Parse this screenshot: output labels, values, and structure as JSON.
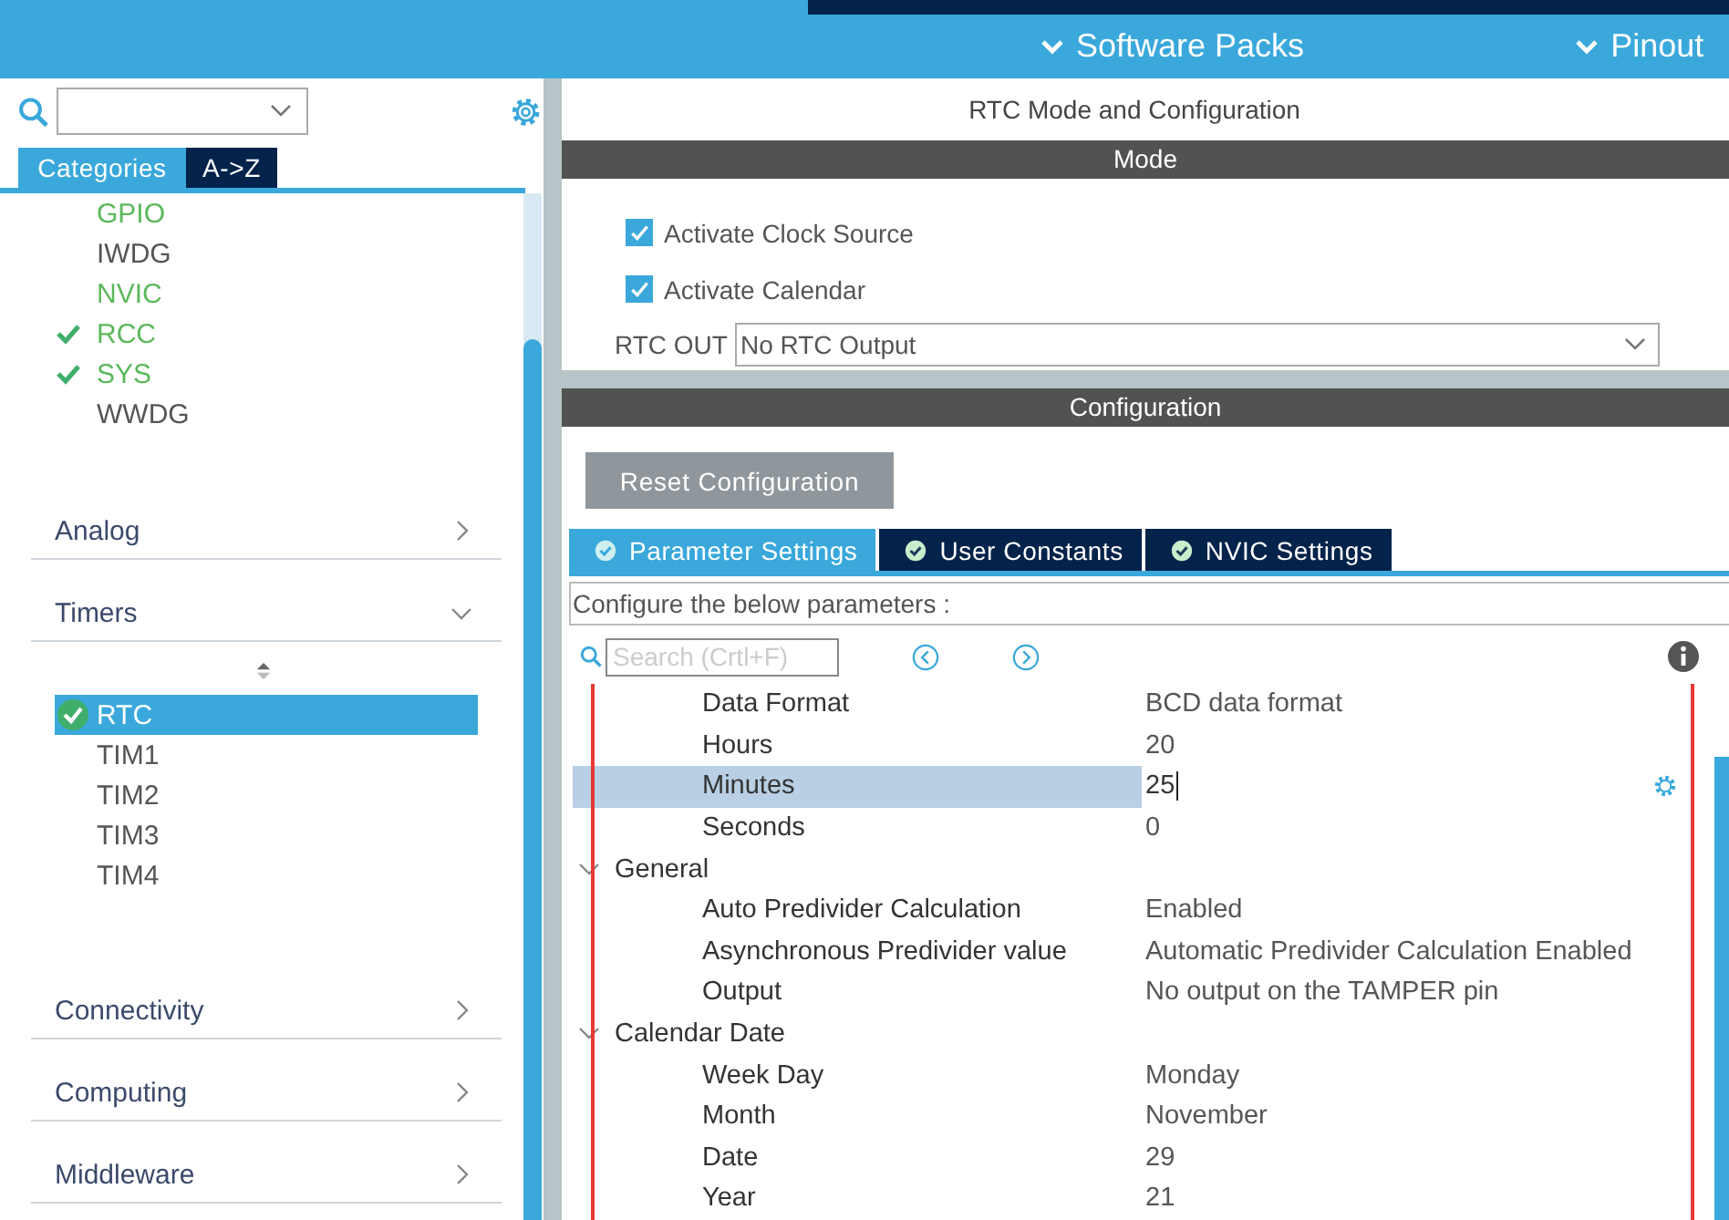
{
  "header": {
    "menus": [
      {
        "label": "Software Packs"
      },
      {
        "label": "Pinout"
      }
    ]
  },
  "sidebar": {
    "tabs": [
      {
        "label": "Categories",
        "selected": true
      },
      {
        "label": "A->Z",
        "selected": false
      }
    ],
    "peripherals": [
      {
        "label": "GPIO",
        "enabled": true,
        "checked": false
      },
      {
        "label": "IWDG",
        "enabled": false,
        "checked": false
      },
      {
        "label": "NVIC",
        "enabled": true,
        "checked": false
      },
      {
        "label": "RCC",
        "enabled": true,
        "checked": true
      },
      {
        "label": "SYS",
        "enabled": true,
        "checked": true
      },
      {
        "label": "WWDG",
        "enabled": false,
        "checked": false
      }
    ],
    "categories": [
      {
        "label": "Analog",
        "expanded": false
      },
      {
        "label": "Timers",
        "expanded": true,
        "children": [
          {
            "label": "RTC",
            "selected": true,
            "checked": true
          },
          {
            "label": "TIM1",
            "selected": false,
            "checked": false
          },
          {
            "label": "TIM2",
            "selected": false,
            "checked": false
          },
          {
            "label": "TIM3",
            "selected": false,
            "checked": false
          },
          {
            "label": "TIM4",
            "selected": false,
            "checked": false
          }
        ]
      },
      {
        "label": "Connectivity",
        "expanded": false
      },
      {
        "label": "Computing",
        "expanded": false
      },
      {
        "label": "Middleware",
        "expanded": false
      }
    ]
  },
  "main": {
    "title": "RTC Mode and Configuration",
    "mode": {
      "heading": "Mode",
      "checkboxes": [
        {
          "label": "Activate Clock Source",
          "checked": true
        },
        {
          "label": "Activate Calendar",
          "checked": true
        }
      ],
      "rtc_out": {
        "label": "RTC OUT",
        "value": "No RTC Output"
      }
    },
    "configuration": {
      "heading": "Configuration",
      "reset_button": "Reset Configuration",
      "tabs": [
        {
          "label": "Parameter Settings",
          "selected": true
        },
        {
          "label": "User Constants",
          "selected": false
        },
        {
          "label": "NVIC Settings",
          "selected": false
        }
      ],
      "description": "Configure the below parameters :",
      "search": {
        "placeholder": "Search (Crtl+F)"
      },
      "parameters": [
        {
          "label": "Data Format",
          "value": "BCD data format",
          "selected": false
        },
        {
          "label": "Hours",
          "value": "20",
          "selected": false
        },
        {
          "label": "Minutes",
          "value": "25",
          "selected": true
        },
        {
          "label": "Seconds",
          "value": "0",
          "selected": false
        },
        {
          "label": "General",
          "expanded": true,
          "children": [
            {
              "label": "Auto Predivider Calculation",
              "value": "Enabled",
              "selected": false
            },
            {
              "label": "Asynchronous Predivider value",
              "value": "Automatic Predivider Calculation Enabled",
              "selected": false
            },
            {
              "label": "Output",
              "value": "No output on the TAMPER pin",
              "selected": false
            }
          ]
        },
        {
          "label": "Calendar Date",
          "expanded": true,
          "children": [
            {
              "label": "Week Day",
              "value": "Monday",
              "selected": false
            },
            {
              "label": "Month",
              "value": "November",
              "selected": false
            },
            {
              "label": "Date",
              "value": "29",
              "selected": false
            },
            {
              "label": "Year",
              "value": "21",
              "selected": false
            }
          ]
        }
      ]
    }
  }
}
